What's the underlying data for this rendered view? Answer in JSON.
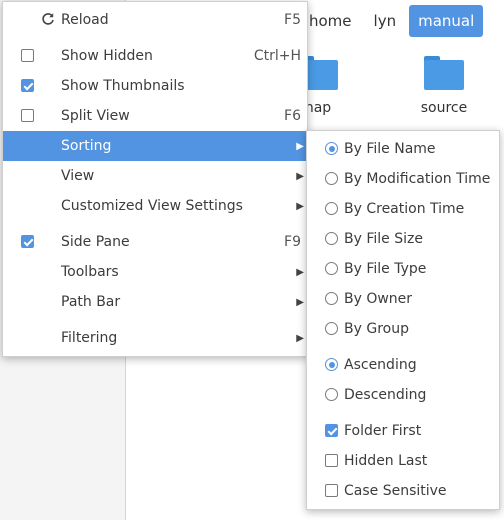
{
  "breadcrumb": {
    "items": [
      "home",
      "lyn",
      "manual"
    ],
    "active_index": 2
  },
  "folders": [
    {
      "label": "nap"
    },
    {
      "label": "source"
    }
  ],
  "accent_color": "#5294e2",
  "main_menu": {
    "reload": {
      "label": "Reload",
      "shortcut": "F5",
      "icon": "reload-icon"
    },
    "show_hidden": {
      "label": "Show Hidden",
      "shortcut": "Ctrl+H",
      "checked": false
    },
    "show_thumbnails": {
      "label": "Show Thumbnails",
      "checked": true
    },
    "split_view": {
      "label": "Split View",
      "shortcut": "F6",
      "checked": false
    },
    "sorting": {
      "label": "Sorting",
      "highlighted": true
    },
    "view": {
      "label": "View"
    },
    "customized_view_settings": {
      "label": "Customized View Settings"
    },
    "side_pane": {
      "label": "Side Pane",
      "shortcut": "F9",
      "checked": true
    },
    "toolbars": {
      "label": "Toolbars"
    },
    "path_bar": {
      "label": "Path Bar"
    },
    "filtering": {
      "label": "Filtering"
    },
    "submenu_arrow": "▶"
  },
  "sorting_menu": {
    "by_file_name": {
      "label": "By File Name",
      "selected": true
    },
    "by_modification_time": {
      "label": "By Modification Time",
      "selected": false
    },
    "by_creation_time": {
      "label": "By Creation Time",
      "selected": false
    },
    "by_file_size": {
      "label": "By File Size",
      "selected": false
    },
    "by_file_type": {
      "label": "By File Type",
      "selected": false
    },
    "by_owner": {
      "label": "By Owner",
      "selected": false
    },
    "by_group": {
      "label": "By Group",
      "selected": false
    },
    "ascending": {
      "label": "Ascending",
      "selected": true
    },
    "descending": {
      "label": "Descending",
      "selected": false
    },
    "folder_first": {
      "label": "Folder First",
      "checked": true
    },
    "hidden_last": {
      "label": "Hidden Last",
      "checked": false
    },
    "case_sensitive": {
      "label": "Case Sensitive",
      "checked": false
    }
  }
}
